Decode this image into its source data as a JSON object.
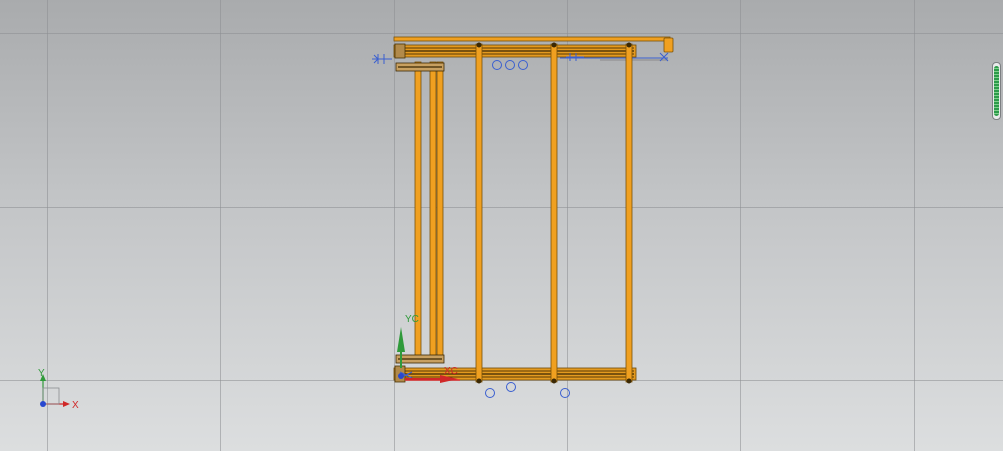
{
  "viewport": {
    "background_top": "#a9abad",
    "background_bottom": "#dcdedf",
    "grid_color": "#8c8e91"
  },
  "model": {
    "frame_color": "#f0a020",
    "frame_edge_color": "#7a5208",
    "marker_color": "#3a5fd0"
  },
  "wcs_triad": {
    "y_label": "Y",
    "x_label": "X",
    "y_color": "#2f9a3a",
    "x_color": "#d02828",
    "z_color": "#2848d0"
  },
  "work_csys": {
    "yc_label": "YC",
    "xc_label": "XC",
    "yc_color": "#2f9a3a",
    "xc_color": "#d02828"
  },
  "scroll_indicator": {
    "level": 1.0,
    "color": "#2c9b4a"
  }
}
